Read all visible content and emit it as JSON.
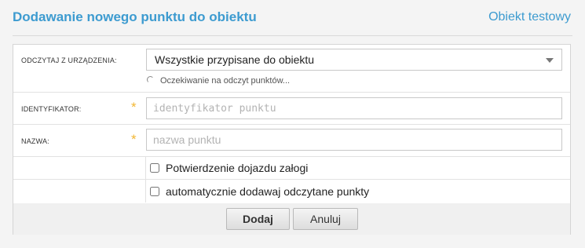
{
  "header": {
    "title": "Dodawanie nowego punktu do obiektu",
    "object_link": "Obiekt testowy"
  },
  "form": {
    "device": {
      "label": "ODCZYTAJ Z URZĄDZENIA:",
      "selected": "Wszystkie przypisane do obiektu",
      "status": "Oczekiwanie na odczyt punktów..."
    },
    "identifier": {
      "label": "IDENTYFIKATOR:",
      "required_mark": "*",
      "placeholder": "identyfikator punktu",
      "value": ""
    },
    "name": {
      "label": "NAZWA:",
      "required_mark": "*",
      "placeholder": "nazwa punktu",
      "value": ""
    },
    "crew_confirm": {
      "label": "Potwierdzenie dojazdu załogi",
      "checked": false
    },
    "auto_add": {
      "label": "automatycznie dodawaj odczytane punkty",
      "checked": false
    }
  },
  "buttons": {
    "add_label": "Dodaj",
    "cancel_label": "Anuluj"
  },
  "colors": {
    "accent": "#3d9bd0",
    "required": "#f2b632",
    "panel_border": "#d5d5d5"
  }
}
